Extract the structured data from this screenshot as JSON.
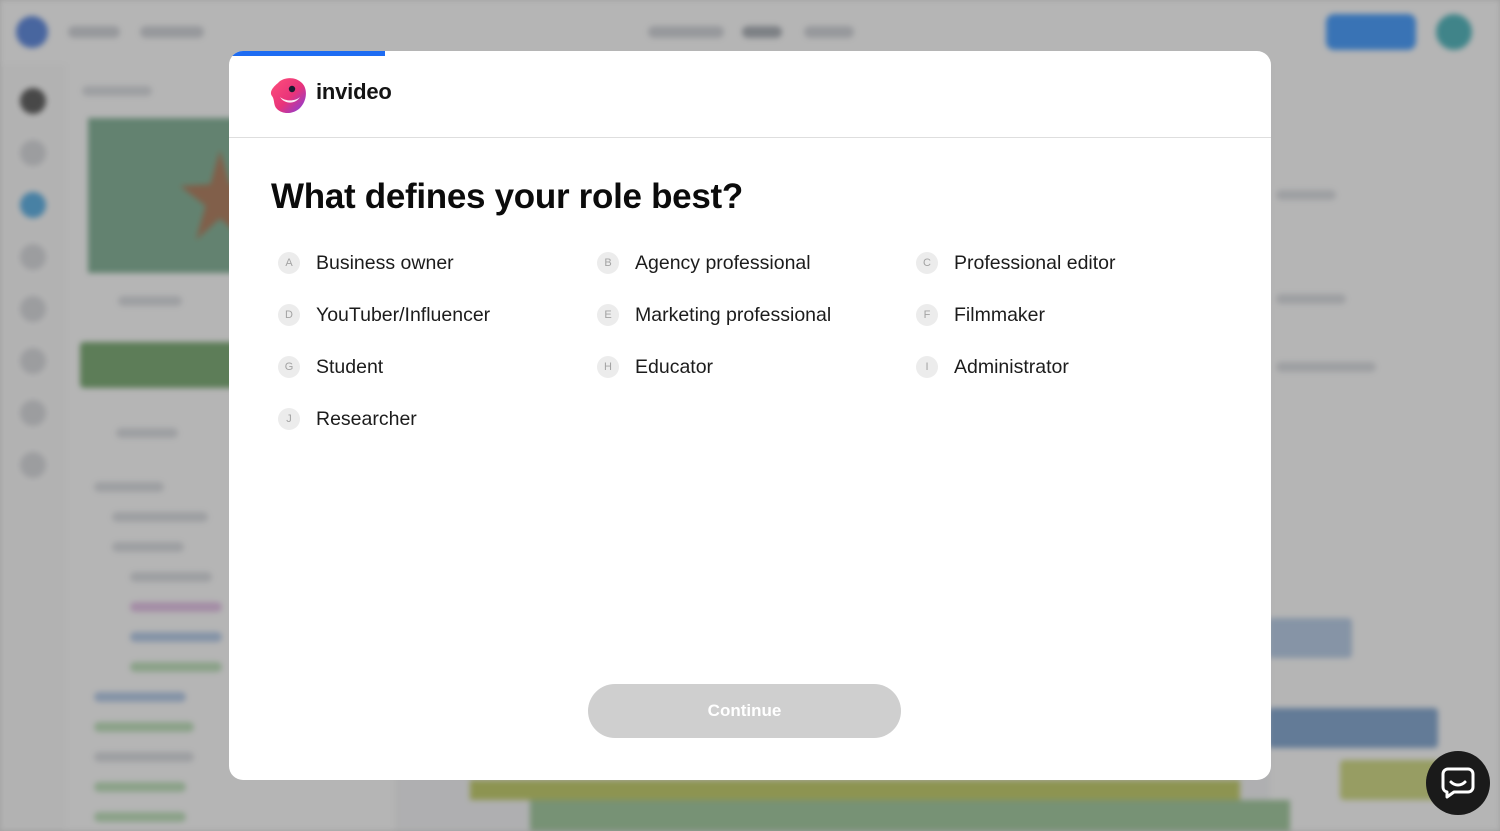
{
  "modal": {
    "brand_name": "invideo",
    "progress_percent": 15,
    "question": "What defines your role best?",
    "options": [
      {
        "key": "A",
        "label": "Business owner"
      },
      {
        "key": "B",
        "label": "Agency professional"
      },
      {
        "key": "C",
        "label": "Professional editor"
      },
      {
        "key": "D",
        "label": "YouTuber/Influencer"
      },
      {
        "key": "E",
        "label": "Marketing professional"
      },
      {
        "key": "F",
        "label": "Filmmaker"
      },
      {
        "key": "G",
        "label": "Student"
      },
      {
        "key": "H",
        "label": "Educator"
      },
      {
        "key": "I",
        "label": "Administrator"
      },
      {
        "key": "J",
        "label": "Researcher"
      }
    ],
    "continue_label": "Continue",
    "continue_enabled": false
  },
  "colors": {
    "progress": "#1e6cf2",
    "continue_disabled": "#cfcfcf",
    "badge_bg": "#ececec",
    "brand_pink": "#e8337a",
    "brand_purple": "#7b3fe4"
  },
  "icons": {
    "brand": "invideo-logo-icon",
    "chat": "chat-bubble-icon"
  }
}
